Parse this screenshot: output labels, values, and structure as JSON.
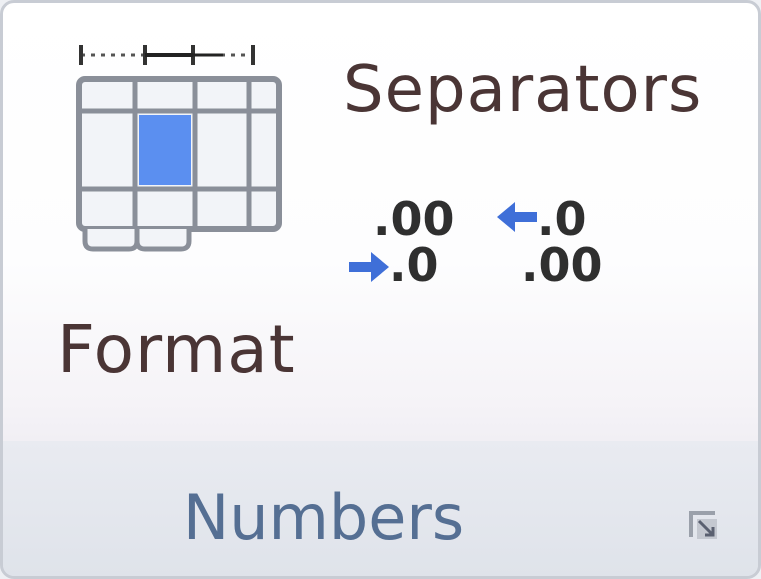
{
  "ribbon_group": {
    "format_button": {
      "label": "Format",
      "icon": "table-format-icon"
    },
    "separators_button": {
      "label": "Separators"
    },
    "increase_decimal": {
      "icon": "increase-decimal-icon",
      "top_text": ".00",
      "bottom_text": ".0"
    },
    "decrease_decimal": {
      "icon": "decrease-decimal-icon",
      "top_text": ".0",
      "bottom_text": ".00"
    },
    "group_label": "Numbers",
    "dialog_launcher": {
      "icon": "dialog-launcher-icon"
    }
  },
  "colors": {
    "label_text": "#4a3535",
    "group_label_text": "#556f93",
    "accent_blue": "#3f6fd8",
    "table_highlight": "#5b8ff0"
  }
}
